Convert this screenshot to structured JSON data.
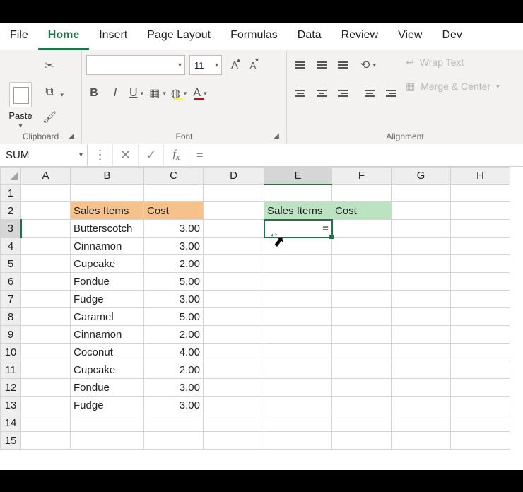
{
  "tabs": {
    "file": "File",
    "home": "Home",
    "insert": "Insert",
    "page_layout": "Page Layout",
    "formulas": "Formulas",
    "data": "Data",
    "review": "Review",
    "view": "View",
    "developer": "Dev"
  },
  "ribbon": {
    "clipboard": {
      "paste": "Paste",
      "label": "Clipboard"
    },
    "font": {
      "name": "",
      "size": "11",
      "bold": "B",
      "italic": "I",
      "underline": "U",
      "label": "Font"
    },
    "align": {
      "wrap": "Wrap Text",
      "merge": "Merge & Center",
      "label": "Alignment"
    }
  },
  "formula_bar": {
    "namebox": "SUM",
    "formula": "="
  },
  "columns": [
    "A",
    "B",
    "C",
    "D",
    "E",
    "F",
    "G",
    "H"
  ],
  "grid": {
    "header_b2": "Sales Items",
    "header_c2": "Cost",
    "header_e2": "Sales Items",
    "header_f2": "Cost",
    "rows": [
      {
        "n": 3,
        "item": "Butterscotch",
        "cost": "3.00"
      },
      {
        "n": 4,
        "item": "Cinnamon",
        "cost": "3.00"
      },
      {
        "n": 5,
        "item": "Cupcake",
        "cost": "2.00"
      },
      {
        "n": 6,
        "item": "Fondue",
        "cost": "5.00"
      },
      {
        "n": 7,
        "item": "Fudge",
        "cost": "3.00"
      },
      {
        "n": 8,
        "item": "Caramel",
        "cost": "5.00"
      },
      {
        "n": 9,
        "item": "Cinnamon",
        "cost": "2.00"
      },
      {
        "n": 10,
        "item": "Coconut",
        "cost": "4.00"
      },
      {
        "n": 11,
        "item": "Cupcake",
        "cost": "2.00"
      },
      {
        "n": 12,
        "item": "Fondue",
        "cost": "3.00"
      },
      {
        "n": 13,
        "item": "Fudge",
        "cost": "3.00"
      }
    ],
    "editing_cell_value": "="
  },
  "chart_data": {
    "type": "table",
    "title": "Sales Items and Cost",
    "columns": [
      "Sales Items",
      "Cost"
    ],
    "rows": [
      [
        "Butterscotch",
        3.0
      ],
      [
        "Cinnamon",
        3.0
      ],
      [
        "Cupcake",
        2.0
      ],
      [
        "Fondue",
        5.0
      ],
      [
        "Fudge",
        3.0
      ],
      [
        "Caramel",
        5.0
      ],
      [
        "Cinnamon",
        2.0
      ],
      [
        "Coconut",
        4.0
      ],
      [
        "Cupcake",
        2.0
      ],
      [
        "Fondue",
        3.0
      ],
      [
        "Fudge",
        3.0
      ]
    ]
  }
}
